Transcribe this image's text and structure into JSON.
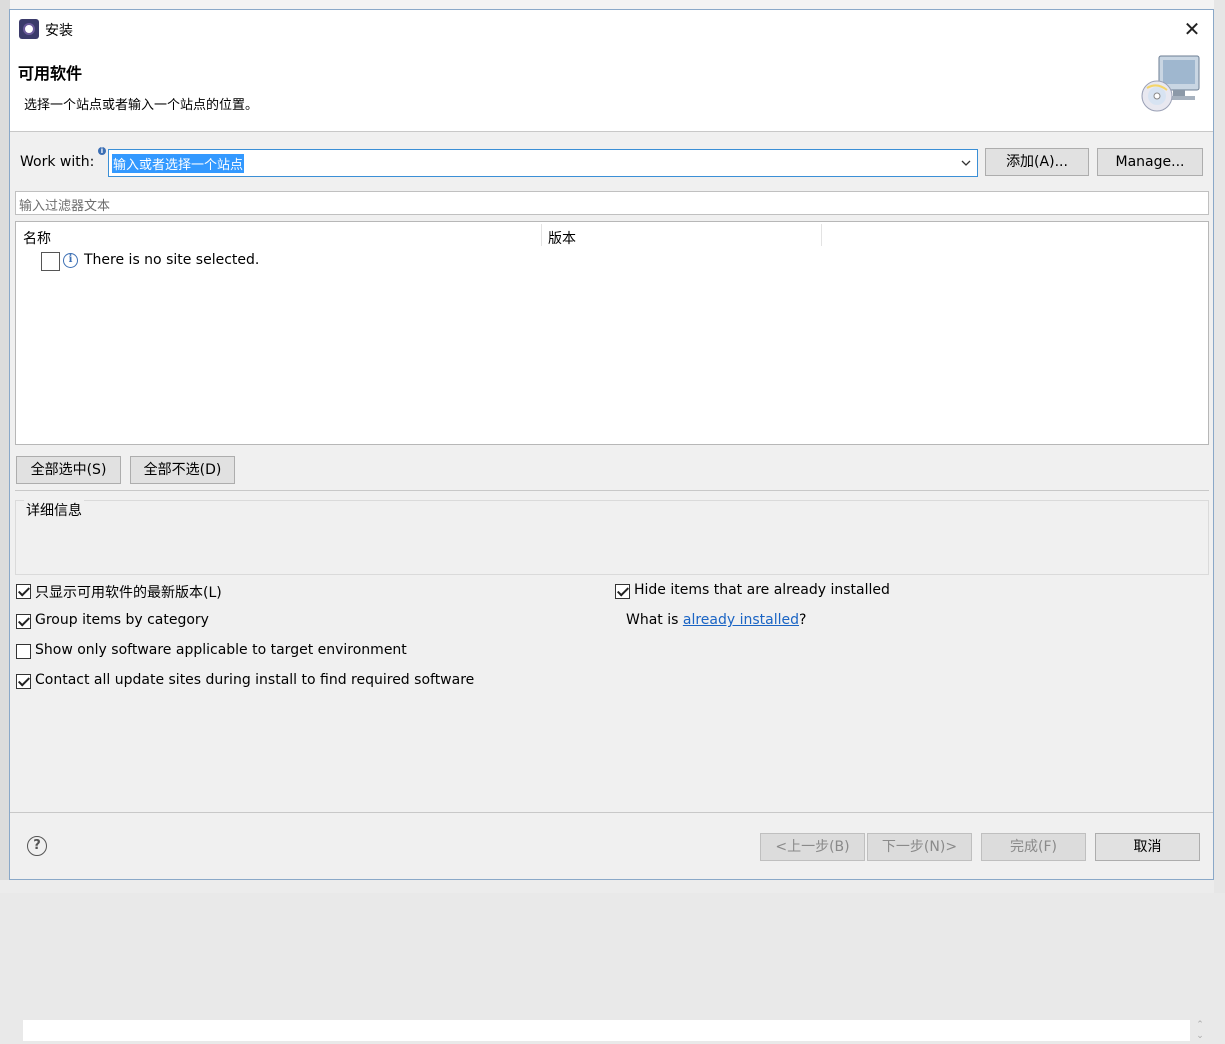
{
  "window": {
    "title": "安装",
    "close_glyph": "✕"
  },
  "header": {
    "title": "可用软件",
    "description": "选择一个站点或者输入一个站点的位置。",
    "image_icon": "install-monitor-cd-icon"
  },
  "work_with": {
    "label": "Work with:",
    "value": "输入或者选择一个站点",
    "add_button": "添加(A)...",
    "manage_button": "Manage..."
  },
  "filter": {
    "placeholder": "输入过滤器文本"
  },
  "tree": {
    "columns": [
      "名称",
      "版本"
    ],
    "rows": [
      {
        "checked": false,
        "icon": "info-icon",
        "text": "There is no site selected."
      }
    ]
  },
  "selection_buttons": {
    "select_all": "全部选中(S)",
    "deselect_all": "全部不选(D)"
  },
  "details": {
    "label": "详细信息",
    "value": ""
  },
  "options": {
    "left": [
      {
        "label": "只显示可用软件的最新版本(L)",
        "checked": true
      },
      {
        "label": "Group items by category",
        "checked": true
      },
      {
        "label": "Show only software applicable to target environment",
        "checked": false
      },
      {
        "label": "Contact all update sites during install to find required software",
        "checked": true
      }
    ],
    "hide_installed": {
      "label": "Hide items that are already installed",
      "checked": true
    },
    "what_is": {
      "prefix": "What is ",
      "link": "already installed",
      "suffix": "?"
    }
  },
  "footer": {
    "help_glyph": "?",
    "back": "<上一步(B)",
    "next": "下一步(N)>",
    "finish": "完成(F)",
    "cancel": "取消"
  },
  "colors": {
    "accent": "#3399ff",
    "link": "#1a64c4",
    "dialog_bg": "#f0f0f0"
  }
}
